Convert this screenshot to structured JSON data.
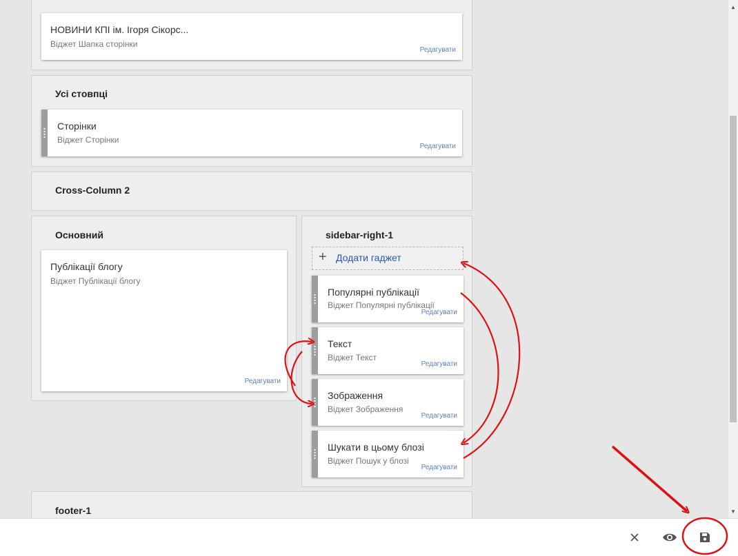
{
  "header_section": {
    "widget": {
      "name": "НОВИНИ КПІ ім. Ігоря Сікорс...",
      "desc": "Віджет Шапка сторінки",
      "edit": "Редагувати"
    }
  },
  "all_columns": {
    "title": "Усі стовпці",
    "widget": {
      "name": "Сторінки",
      "desc": "Віджет Сторінки",
      "edit": "Редагувати"
    }
  },
  "cross_column_2": {
    "title": "Cross-Column 2"
  },
  "main": {
    "title": "Основний",
    "widget": {
      "name": "Публікації блогу",
      "desc": "Віджет Публікації блогу",
      "edit": "Редагувати"
    }
  },
  "sidebar": {
    "title": "sidebar-right-1",
    "add_gadget": "Додати гаджет",
    "widgets": [
      {
        "name": "Популярні публікації",
        "desc": "Віджет Популярні публікації",
        "edit": "Редагувати"
      },
      {
        "name": "Текст",
        "desc": "Віджет Текст",
        "edit": "Редагувати"
      },
      {
        "name": "Зображення",
        "desc": "Віджет Зображення",
        "edit": "Редагувати"
      },
      {
        "name": "Шукати в цьому блозі",
        "desc": "Віджет Пошук у блозі",
        "edit": "Редагувати"
      }
    ]
  },
  "footer": {
    "title": "footer-1"
  },
  "toolbar": {
    "close_icon": "close-icon",
    "preview_icon": "eye-icon",
    "save_icon": "save-icon"
  },
  "colors": {
    "annotation": "#e01010",
    "link": "#2a56b8",
    "edit_link": "#5b7fc0"
  }
}
